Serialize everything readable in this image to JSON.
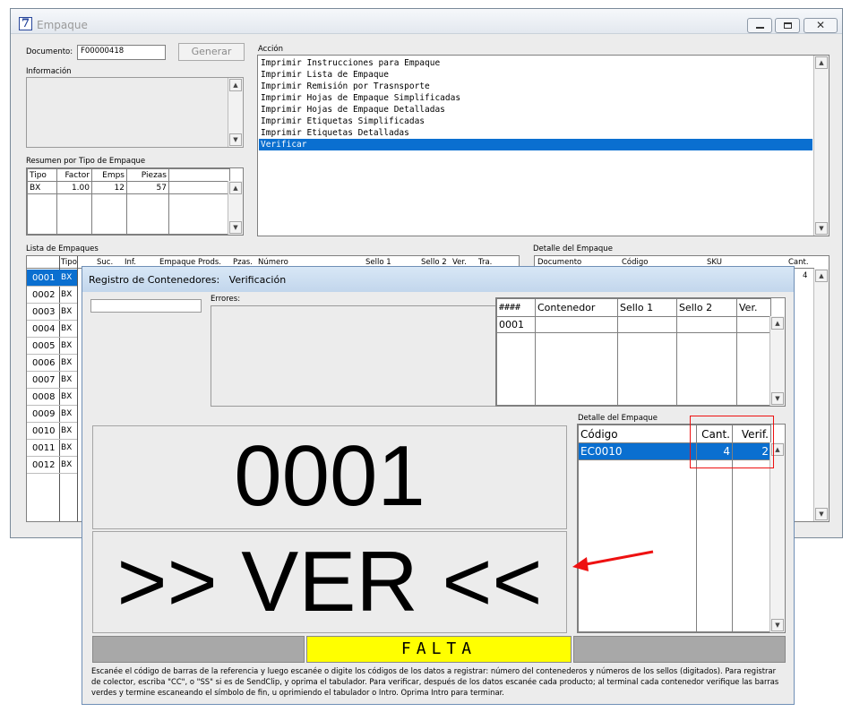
{
  "main_window": {
    "icon": "7",
    "title": "Empaque",
    "documento_label": "Documento:",
    "documento_value": "F00000418",
    "generar_label": "Generar",
    "informacion_label": "Información",
    "accion_label": "Acción",
    "acciones": [
      "Imprimir Instrucciones para Empaque",
      "Imprimir Lista de Empaque",
      "Imprimir Remisión por Trasnsporte",
      "Imprimir Hojas de Empaque Simplificadas",
      "Imprimir Hojas de Empaque Detalladas",
      "Imprimir Etiquetas Simplificadas",
      "Imprimir Etiquetas Detalladas",
      "Verificar"
    ],
    "resumen_label": "Resumen por Tipo de Empaque",
    "resumen_headers": [
      "Tipo",
      "Factor",
      "Emps",
      "Piezas"
    ],
    "resumen_row": [
      "BX",
      "1.00",
      "12",
      "57"
    ],
    "lista_label": "Lista de Empaques",
    "lista_headers": [
      "Tipo",
      "Suc.",
      "Inf.",
      "Empaque",
      "Prods.",
      "Pzas.",
      "Número",
      "Sello 1",
      "Sello 2",
      "Ver.",
      "Tra."
    ],
    "lista_rows": [
      [
        "0001",
        "BX"
      ],
      [
        "0002",
        "BX"
      ],
      [
        "0003",
        "BX"
      ],
      [
        "0004",
        "BX"
      ],
      [
        "0005",
        "BX"
      ],
      [
        "0006",
        "BX"
      ],
      [
        "0007",
        "BX"
      ],
      [
        "0008",
        "BX"
      ],
      [
        "0009",
        "BX"
      ],
      [
        "0010",
        "BX"
      ],
      [
        "0011",
        "BX"
      ],
      [
        "0012",
        "BX"
      ]
    ],
    "detalle_label": "Detalle del Empaque",
    "detalle_headers": [
      "Documento",
      "Código",
      "SKU",
      "Cant."
    ],
    "detalle_cant_value": "4"
  },
  "dialog": {
    "title": "Registro de Contenedores:   Verificación",
    "errores_label": "Errores:",
    "cont_headers": [
      "####",
      "Contenedor",
      "Sello 1",
      "Sello 2",
      "Ver."
    ],
    "cont_row": [
      "0001",
      "",
      "",
      "",
      ""
    ],
    "detalle_label": "Detalle del Empaque",
    "detalle_headers": [
      "Código",
      "Cant.",
      "Verif."
    ],
    "detalle_row": [
      "EC0010",
      "4",
      "2"
    ],
    "big_number": "0001",
    "big_status": ">> VER <<",
    "falta": "FALTA",
    "instructions": "Escanée el código de barras de la referencia y luego escanée o digite los códigos de los datos a registrar: número del contenederos y números de los sellos (digitados). Para registrar de colector, escriba \"CC\", o \"SS\" si es de SendClip, y oprima el tabulador. Para verificar, después de los datos escanée cada producto; al terminal cada contenedor verifique las barras verdes y termine escaneando el símbolo de fin, u oprimiendo el tabulador o Intro. Oprima Intro para terminar."
  },
  "colors": {
    "selection": "#0a6fd0",
    "falta_yellow": "#ffff00",
    "annotation_red": "#ee1111"
  }
}
